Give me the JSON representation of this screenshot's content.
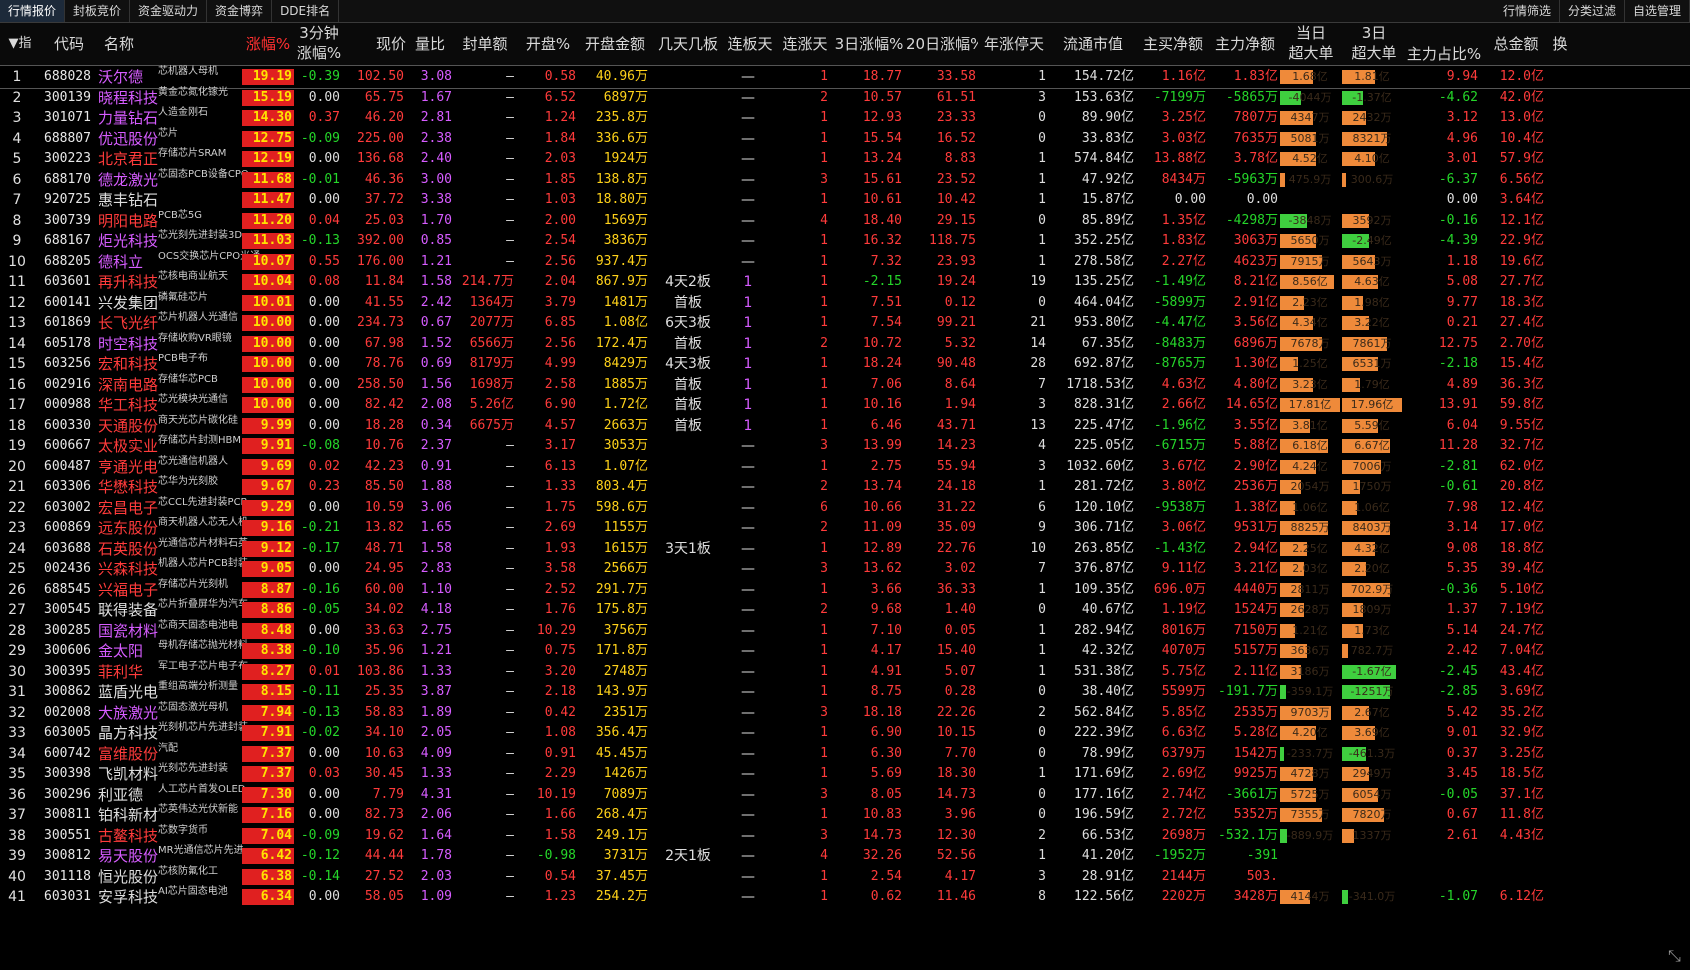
{
  "tabs": [
    "行情报价",
    "封板竞价",
    "资金驱动力",
    "资金博弈",
    "DDE排名"
  ],
  "top_right": [
    "行情筛选",
    "分类过滤",
    "自选管理"
  ],
  "header": {
    "zhi": "▼指",
    "code": "代码",
    "name": "名称",
    "pct": "涨幅%",
    "m3a": "3分钟",
    "m3b": "涨幅%",
    "price": "现价",
    "vr": "量比",
    "seal": "封单额",
    "open_pct": "开盘%",
    "open_amt": "开盘金额",
    "board": "几天几板",
    "lb": "连板天",
    "lz": "连涨天",
    "d3": "3日涨幅%",
    "d20": "20日涨幅%",
    "nzt": "年涨停天",
    "mcap": "流通市值",
    "zm": "主买净额",
    "zl": "主力净额",
    "day_a": "当日",
    "day_b": "超大单",
    "d3a": "3日",
    "d3b": "超大单",
    "ratio": "主力占比%",
    "total": "总金额",
    "extra": "换"
  },
  "rows": [
    [
      "1",
      "688028",
      "沃尔德",
      "芯机器人母机",
      "19.19",
      "-0.39",
      "102.50",
      "3.08",
      "—",
      "0.58",
      "40.96万",
      "",
      "—",
      "1",
      "18.77",
      "33.58",
      "1",
      "154.72亿",
      "1.16亿",
      "1.83亿",
      "1.68亿",
      "1.81亿",
      "9.94",
      "12.0亿"
    ],
    [
      "2",
      "300139",
      "晓程科技",
      "黄金芯氮化镓光",
      "15.19",
      "0.00",
      "65.75",
      "1.67",
      "—",
      "6.52",
      "6897万",
      "",
      "—",
      "2",
      "10.57",
      "61.51",
      "3",
      "153.63亿",
      "-7199万",
      "-5865万",
      "-4044万",
      "-1.37亿",
      "-4.62",
      "42.0亿"
    ],
    [
      "3",
      "301071",
      "力量钻石",
      "人造金刚石",
      "14.30",
      "0.37",
      "46.20",
      "2.81",
      "—",
      "1.24",
      "235.8万",
      "",
      "—",
      "1",
      "12.93",
      "23.33",
      "0",
      "89.90亿",
      "3.25亿",
      "7807万",
      "4347万",
      "2432万",
      "3.12",
      "13.0亿"
    ],
    [
      "4",
      "688807",
      "优迅股份",
      "芯片",
      "12.75",
      "-0.09",
      "225.00",
      "2.38",
      "—",
      "1.84",
      "336.6万",
      "",
      "—",
      "1",
      "15.54",
      "16.52",
      "0",
      "33.83亿",
      "3.03亿",
      "7635万",
      "5081万",
      "8321万",
      "4.96",
      "10.4亿"
    ],
    [
      "5",
      "300223",
      "北京君正",
      "存储芯片SRAM",
      "12.19",
      "0.00",
      "136.68",
      "2.40",
      "—",
      "2.03",
      "1924万",
      "",
      "—",
      "1",
      "13.24",
      "8.83",
      "1",
      "574.84亿",
      "13.88亿",
      "3.78亿",
      "4.52亿",
      "4.10亿",
      "3.01",
      "57.9亿"
    ],
    [
      "6",
      "688170",
      "德龙激光",
      "芯固态PCB设备CPO",
      "11.68",
      "-0.01",
      "46.36",
      "3.00",
      "—",
      "1.85",
      "138.8万",
      "",
      "—",
      "3",
      "15.61",
      "23.52",
      "1",
      "47.92亿",
      "8434万",
      "-5963万",
      "475.9万",
      "300.6万",
      "-6.37",
      "6.56亿"
    ],
    [
      "7",
      "920725",
      "惠丰钻石",
      "",
      "11.47",
      "0.00",
      "37.72",
      "3.38",
      "—",
      "1.03",
      "18.80万",
      "",
      "—",
      "1",
      "10.61",
      "10.42",
      "1",
      "15.87亿",
      "0.00",
      "0.00",
      "",
      "",
      "0.00",
      "3.64亿"
    ],
    [
      "8",
      "300739",
      "明阳电路",
      "PCB芯5G",
      "11.20",
      "0.04",
      "25.03",
      "1.70",
      "—",
      "2.00",
      "1569万",
      "",
      "—",
      "4",
      "18.40",
      "29.15",
      "0",
      "85.89亿",
      "1.35亿",
      "-4298万",
      "-3848万",
      "3592万",
      "-0.16",
      "12.1亿"
    ],
    [
      "9",
      "688167",
      "炬光科技",
      "芯光刻先进封装3D",
      "11.03",
      "-0.13",
      "392.00",
      "0.85",
      "—",
      "2.54",
      "3836万",
      "",
      "—",
      "1",
      "16.32",
      "118.75",
      "1",
      "352.25亿",
      "1.83亿",
      "3063万",
      "5650万",
      "-2.49亿",
      "-4.39",
      "22.9亿"
    ],
    [
      "10",
      "688205",
      "德科立",
      "OCS交换芯片CPO光通",
      "10.07",
      "0.55",
      "176.00",
      "1.21",
      "—",
      "2.56",
      "937.4万",
      "",
      "—",
      "1",
      "7.32",
      "23.93",
      "1",
      "278.58亿",
      "2.27亿",
      "4623万",
      "7915万",
      "5643万",
      "1.18",
      "19.6亿"
    ],
    [
      "11",
      "603601",
      "再升科技",
      "芯核电商业航天",
      "10.04",
      "0.08",
      "11.84",
      "1.58",
      "214.7万",
      "2.04",
      "867.9万",
      "4天2板",
      "1",
      "1",
      "-2.15",
      "19.24",
      "19",
      "135.25亿",
      "-1.49亿",
      "8.21亿",
      "8.56亿",
      "4.63亿",
      "5.08",
      "27.7亿"
    ],
    [
      "12",
      "600141",
      "兴发集团",
      "磷氟硅芯片",
      "10.01",
      "0.00",
      "41.55",
      "2.42",
      "1364万",
      "3.79",
      "1481万",
      "首板",
      "1",
      "1",
      "7.51",
      "0.12",
      "0",
      "464.04亿",
      "-5899万",
      "2.91亿",
      "2.23亿",
      "1.98亿",
      "9.77",
      "18.3亿"
    ],
    [
      "13",
      "601869",
      "长飞光纤",
      "芯片机器人光通信",
      "10.00",
      "0.00",
      "234.73",
      "0.67",
      "2077万",
      "6.85",
      "1.08亿",
      "6天3板",
      "1",
      "1",
      "7.54",
      "99.21",
      "21",
      "953.80亿",
      "-4.47亿",
      "3.56亿",
      "4.34亿",
      "3.22亿",
      "0.21",
      "27.4亿"
    ],
    [
      "14",
      "605178",
      "时空科技",
      "存储收购VR眼镜",
      "10.00",
      "0.00",
      "67.98",
      "1.52",
      "6566万",
      "2.56",
      "172.4万",
      "首板",
      "1",
      "2",
      "10.72",
      "5.32",
      "14",
      "67.35亿",
      "-8483万",
      "6896万",
      "7678万",
      "7861万",
      "12.75",
      "2.70亿"
    ],
    [
      "15",
      "603256",
      "宏和科技",
      "PCB电子布",
      "10.00",
      "0.00",
      "78.76",
      "0.69",
      "8179万",
      "4.99",
      "8429万",
      "4天3板",
      "1",
      "1",
      "18.24",
      "90.48",
      "28",
      "692.87亿",
      "-8765万",
      "1.30亿",
      "1.25亿",
      "6531万",
      "-2.18",
      "15.4亿"
    ],
    [
      "16",
      "002916",
      "深南电路",
      "存储华芯PCB",
      "10.00",
      "0.00",
      "258.50",
      "1.56",
      "1698万",
      "2.58",
      "1885万",
      "首板",
      "1",
      "1",
      "7.06",
      "8.64",
      "7",
      "1718.53亿",
      "4.63亿",
      "4.80亿",
      "3.23亿",
      "1.79亿",
      "4.89",
      "36.3亿"
    ],
    [
      "17",
      "000988",
      "华工科技",
      "芯光模块光通信",
      "10.00",
      "0.00",
      "82.42",
      "2.08",
      "5.26亿",
      "6.90",
      "1.72亿",
      "首板",
      "1",
      "1",
      "10.16",
      "1.94",
      "3",
      "828.31亿",
      "2.66亿",
      "14.65亿",
      "17.81亿",
      "17.96亿",
      "13.91",
      "59.8亿"
    ],
    [
      "18",
      "600330",
      "天通股份",
      "商天光芯片碳化硅",
      "9.99",
      "0.00",
      "18.28",
      "0.34",
      "6675万",
      "4.57",
      "2663万",
      "首板",
      "1",
      "1",
      "6.46",
      "43.71",
      "13",
      "225.47亿",
      "-1.96亿",
      "3.55亿",
      "3.81亿",
      "5.59亿",
      "6.04",
      "9.55亿"
    ],
    [
      "19",
      "600667",
      "太极实业",
      "存储芯片封测HBM",
      "9.91",
      "-0.08",
      "10.76",
      "2.37",
      "—",
      "3.17",
      "3053万",
      "",
      "—",
      "3",
      "13.99",
      "14.23",
      "4",
      "225.05亿",
      "-6715万",
      "5.88亿",
      "6.18亿",
      "6.67亿",
      "11.28",
      "32.7亿"
    ],
    [
      "20",
      "600487",
      "亨通光电",
      "芯光通信机器人",
      "9.69",
      "0.02",
      "42.23",
      "0.91",
      "—",
      "6.13",
      "1.07亿",
      "",
      "—",
      "1",
      "2.75",
      "55.94",
      "3",
      "1032.60亿",
      "3.67亿",
      "2.90亿",
      "4.24亿",
      "7006万",
      "-2.81",
      "62.0亿"
    ],
    [
      "21",
      "603306",
      "华懋科技",
      "芯华为光刻胶",
      "9.67",
      "0.23",
      "85.50",
      "1.88",
      "—",
      "1.33",
      "803.4万",
      "",
      "—",
      "2",
      "13.74",
      "24.18",
      "1",
      "281.72亿",
      "3.80亿",
      "2536万",
      "2054万",
      "1750万",
      "-0.61",
      "20.8亿"
    ],
    [
      "22",
      "603002",
      "宏昌电子",
      "芯CCL先进封装PCB",
      "9.29",
      "0.00",
      "10.59",
      "3.06",
      "—",
      "1.75",
      "598.6万",
      "",
      "—",
      "6",
      "10.66",
      "31.22",
      "6",
      "120.10亿",
      "-9538万",
      "1.38亿",
      "1.06亿",
      "1.06亿",
      "7.98",
      "12.4亿"
    ],
    [
      "23",
      "600869",
      "远东股份",
      "商天机器人芯无人机",
      "9.16",
      "-0.21",
      "13.82",
      "1.65",
      "—",
      "2.69",
      "1155万",
      "",
      "—",
      "2",
      "11.09",
      "35.09",
      "9",
      "306.71亿",
      "3.06亿",
      "9531万",
      "8825万",
      "8403万",
      "3.14",
      "17.0亿"
    ],
    [
      "24",
      "603688",
      "石英股份",
      "光通信芯片材料石英",
      "9.12",
      "-0.17",
      "48.71",
      "1.58",
      "—",
      "1.93",
      "1615万",
      "3天1板",
      "—",
      "1",
      "12.89",
      "22.76",
      "10",
      "263.85亿",
      "-1.43亿",
      "2.94亿",
      "2.25亿",
      "4.32亿",
      "9.08",
      "18.8亿"
    ],
    [
      "25",
      "002436",
      "兴森科技",
      "机器人芯片PCB封装",
      "9.05",
      "0.00",
      "24.95",
      "2.83",
      "—",
      "3.58",
      "2566万",
      "",
      "—",
      "3",
      "13.62",
      "3.02",
      "7",
      "376.87亿",
      "9.11亿",
      "3.21亿",
      "2.03亿",
      "2.20亿",
      "5.35",
      "39.4亿"
    ],
    [
      "26",
      "688545",
      "兴福电子",
      "存储芯片光刻机",
      "8.87",
      "-0.16",
      "60.00",
      "1.10",
      "—",
      "2.52",
      "291.7万",
      "",
      "—",
      "1",
      "3.66",
      "36.33",
      "1",
      "109.35亿",
      "696.0万",
      "4440万",
      "2811万",
      "702.9万",
      "-0.36",
      "5.10亿"
    ],
    [
      "27",
      "300545",
      "联得装备",
      "芯片折叠屏华为汽车",
      "8.86",
      "-0.05",
      "34.02",
      "4.18",
      "—",
      "1.76",
      "175.8万",
      "",
      "—",
      "2",
      "9.68",
      "1.40",
      "0",
      "40.67亿",
      "1.19亿",
      "1524万",
      "2628万",
      "1809万",
      "1.37",
      "7.19亿"
    ],
    [
      "28",
      "300285",
      "国瓷材料",
      "芯商天固态电池电",
      "8.48",
      "0.00",
      "33.63",
      "2.75",
      "—",
      "10.29",
      "3756万",
      "",
      "—",
      "1",
      "7.10",
      "0.05",
      "1",
      "282.94亿",
      "8016万",
      "7150万",
      "1.21亿",
      "1.73亿",
      "5.14",
      "24.7亿"
    ],
    [
      "29",
      "300606",
      "金太阳",
      "母机存储芯抛光材料",
      "8.38",
      "-0.10",
      "35.96",
      "1.21",
      "—",
      "0.75",
      "171.8万",
      "",
      "—",
      "1",
      "4.17",
      "15.40",
      "1",
      "42.32亿",
      "4070万",
      "5157万",
      "3636万",
      "782.7万",
      "2.42",
      "7.04亿"
    ],
    [
      "30",
      "300395",
      "菲利华",
      "军工电子芯片电子布",
      "8.27",
      "0.01",
      "103.86",
      "1.33",
      "—",
      "3.20",
      "2748万",
      "",
      "—",
      "1",
      "4.91",
      "5.07",
      "1",
      "531.38亿",
      "5.75亿",
      "2.11亿",
      "3186万",
      "-1.67亿",
      "-2.45",
      "43.4亿"
    ],
    [
      "31",
      "300862",
      "蓝盾光电",
      "重组高端分析测量",
      "8.15",
      "-0.11",
      "25.35",
      "3.87",
      "—",
      "2.18",
      "143.9万",
      "",
      "—",
      "1",
      "8.75",
      "0.28",
      "0",
      "38.40亿",
      "5599万",
      "-191.7万",
      "-359.1万",
      "-1251万",
      "-2.85",
      "3.69亿"
    ],
    [
      "32",
      "002008",
      "大族激光",
      "芯固态激光母机",
      "7.94",
      "-0.13",
      "58.83",
      "1.89",
      "—",
      "0.42",
      "2351万",
      "",
      "—",
      "3",
      "18.18",
      "22.26",
      "2",
      "562.84亿",
      "5.85亿",
      "2535万",
      "9703万",
      "2.67亿",
      "5.42",
      "35.2亿"
    ],
    [
      "33",
      "603005",
      "晶方科技",
      "光刻机芯片先进封装",
      "7.91",
      "-0.02",
      "34.10",
      "2.05",
      "—",
      "1.08",
      "356.4万",
      "",
      "—",
      "1",
      "6.90",
      "10.15",
      "0",
      "222.39亿",
      "6.63亿",
      "5.28亿",
      "4.20亿",
      "3.69亿",
      "9.01",
      "32.9亿"
    ],
    [
      "34",
      "600742",
      "富维股份",
      "汽配",
      "7.37",
      "0.00",
      "10.63",
      "4.09",
      "—",
      "0.91",
      "45.45万",
      "",
      "—",
      "1",
      "6.30",
      "7.70",
      "0",
      "78.99亿",
      "6379万",
      "1542万",
      "-233.7万",
      "-461.3万",
      "0.37",
      "3.25亿"
    ],
    [
      "35",
      "300398",
      "飞凯材料",
      "光刻芯先进封装",
      "7.37",
      "0.03",
      "30.45",
      "1.33",
      "—",
      "2.29",
      "1426万",
      "",
      "—",
      "1",
      "5.69",
      "18.30",
      "1",
      "171.69亿",
      "2.69亿",
      "9925万",
      "4728万",
      "2949万",
      "3.45",
      "18.5亿"
    ],
    [
      "36",
      "300296",
      "利亚德",
      "人工芯片首发OLED",
      "7.30",
      "0.00",
      "7.79",
      "4.31",
      "—",
      "10.19",
      "7089万",
      "",
      "—",
      "3",
      "8.05",
      "14.73",
      "0",
      "177.16亿",
      "2.74亿",
      "-3661万",
      "5725万",
      "6054万",
      "-0.05",
      "37.1亿"
    ],
    [
      "37",
      "300811",
      "铂科新材",
      "芯英伟达光伏新能",
      "7.16",
      "0.00",
      "82.73",
      "2.06",
      "—",
      "1.66",
      "268.4万",
      "",
      "—",
      "1",
      "10.83",
      "3.96",
      "0",
      "196.59亿",
      "2.72亿",
      "5352万",
      "7355万",
      "7820万",
      "0.67",
      "11.8亿"
    ],
    [
      "38",
      "300551",
      "古鳌科技",
      "芯数字货币",
      "7.04",
      "-0.09",
      "19.62",
      "1.64",
      "—",
      "1.58",
      "249.1万",
      "",
      "—",
      "3",
      "14.73",
      "12.30",
      "2",
      "66.53亿",
      "2698万",
      "-532.1万",
      "-889.9万",
      "1337万",
      "2.61",
      "4.43亿"
    ],
    [
      "39",
      "300812",
      "易天股份",
      "MR光通信芯片先进",
      "6.42",
      "-0.12",
      "44.44",
      "1.78",
      "—",
      "-0.98",
      "3731万",
      "2天1板",
      "—",
      "4",
      "32.26",
      "52.56",
      "1",
      "41.20亿",
      "-1952万",
      "-391",
      "",
      "",
      "",
      ""
    ],
    [
      "40",
      "301118",
      "恒光股份",
      "芯核防氟化工",
      "6.38",
      "-0.14",
      "27.52",
      "2.03",
      "—",
      "0.54",
      "37.45万",
      "",
      "—",
      "1",
      "2.54",
      "4.17",
      "3",
      "28.91亿",
      "2144万",
      "503.",
      "",
      "",
      "",
      ""
    ],
    [
      "41",
      "603031",
      "安孚科技",
      "AI芯片固态电池",
      "6.34",
      "0.00",
      "58.05",
      "1.09",
      "—",
      "1.23",
      "254.2万",
      "",
      "—",
      "1",
      "0.62",
      "11.46",
      "8",
      "122.56亿",
      "2202万",
      "3428万",
      "4144万",
      "-341.0万",
      "-1.07",
      "6.12亿"
    ]
  ],
  "name_colors": [
    "p",
    "p",
    "p",
    "p",
    "r",
    "p",
    "w",
    "r",
    "p",
    "p",
    "r",
    "w",
    "r",
    "p",
    "r",
    "r",
    "r",
    "r",
    "r",
    "r",
    "r",
    "r",
    "r",
    "r",
    "r",
    "r",
    "w",
    "p",
    "p",
    "r",
    "w",
    "p",
    "w",
    "r",
    "w",
    "w",
    "w",
    "r",
    "p",
    "w",
    "w"
  ],
  "bar_fractions": [
    [
      0.55,
      0.55
    ],
    [
      0.35,
      0.35
    ],
    [
      0.55,
      0.4
    ],
    [
      0.6,
      0.75
    ],
    [
      0.6,
      0.55
    ],
    [
      0.08,
      0.05
    ],
    [
      0,
      0
    ],
    [
      0.45,
      0.45
    ],
    [
      0.6,
      0.45
    ],
    [
      0.7,
      0.55
    ],
    [
      0.9,
      0.6
    ],
    [
      0.4,
      0.35
    ],
    [
      0.55,
      0.45
    ],
    [
      0.7,
      0.75
    ],
    [
      0.3,
      0.6
    ],
    [
      0.55,
      0.3
    ],
    [
      1.0,
      1.0
    ],
    [
      0.5,
      0.6
    ],
    [
      0.8,
      0.8
    ],
    [
      0.6,
      0.65
    ],
    [
      0.35,
      0.3
    ],
    [
      0.25,
      0.25
    ],
    [
      0.8,
      0.8
    ],
    [
      0.45,
      0.55
    ],
    [
      0.4,
      0.4
    ],
    [
      0.35,
      0.8
    ],
    [
      0.4,
      0.35
    ],
    [
      0.25,
      0.35
    ],
    [
      0.45,
      0.1
    ],
    [
      0.35,
      0.9
    ],
    [
      0.1,
      0.8
    ],
    [
      0.85,
      0.45
    ],
    [
      0.6,
      0.55
    ],
    [
      0.05,
      0.4
    ],
    [
      0.55,
      0.45
    ],
    [
      0.6,
      0.6
    ],
    [
      0.7,
      0.7
    ],
    [
      0.12,
      0.2
    ],
    [
      0,
      0
    ],
    [
      0,
      0
    ],
    [
      0.5,
      0.1
    ]
  ]
}
